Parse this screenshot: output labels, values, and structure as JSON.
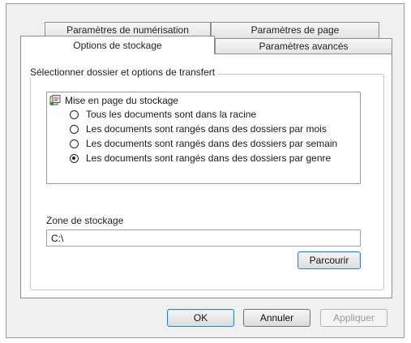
{
  "tabs": {
    "row1": [
      "Paramètres de numérisation",
      "Paramètres de page"
    ],
    "row2": [
      "Options de stockage",
      "Paramètres avancés"
    ],
    "active": "Options de stockage"
  },
  "group": {
    "legend": "Sélectionner dossier et options de transfert"
  },
  "storage_layout": {
    "header": "Mise en page du stockage",
    "icon": "storage-layout-icon",
    "options": [
      {
        "label": "Tous les documents sont dans la racine",
        "checked": false
      },
      {
        "label": "Les documents sont rangés dans des dossiers par mois",
        "checked": false
      },
      {
        "label": "Les documents sont rangés dans des dossiers par semain",
        "checked": false
      },
      {
        "label": "Les documents sont rangés dans des dossiers par genre",
        "checked": true
      }
    ]
  },
  "storage_zone": {
    "label": "Zone de stockage",
    "value": "C:\\",
    "browse_label": "Parcourir"
  },
  "buttons": {
    "ok": "OK",
    "cancel": "Annuler",
    "apply": "Appliquer"
  }
}
